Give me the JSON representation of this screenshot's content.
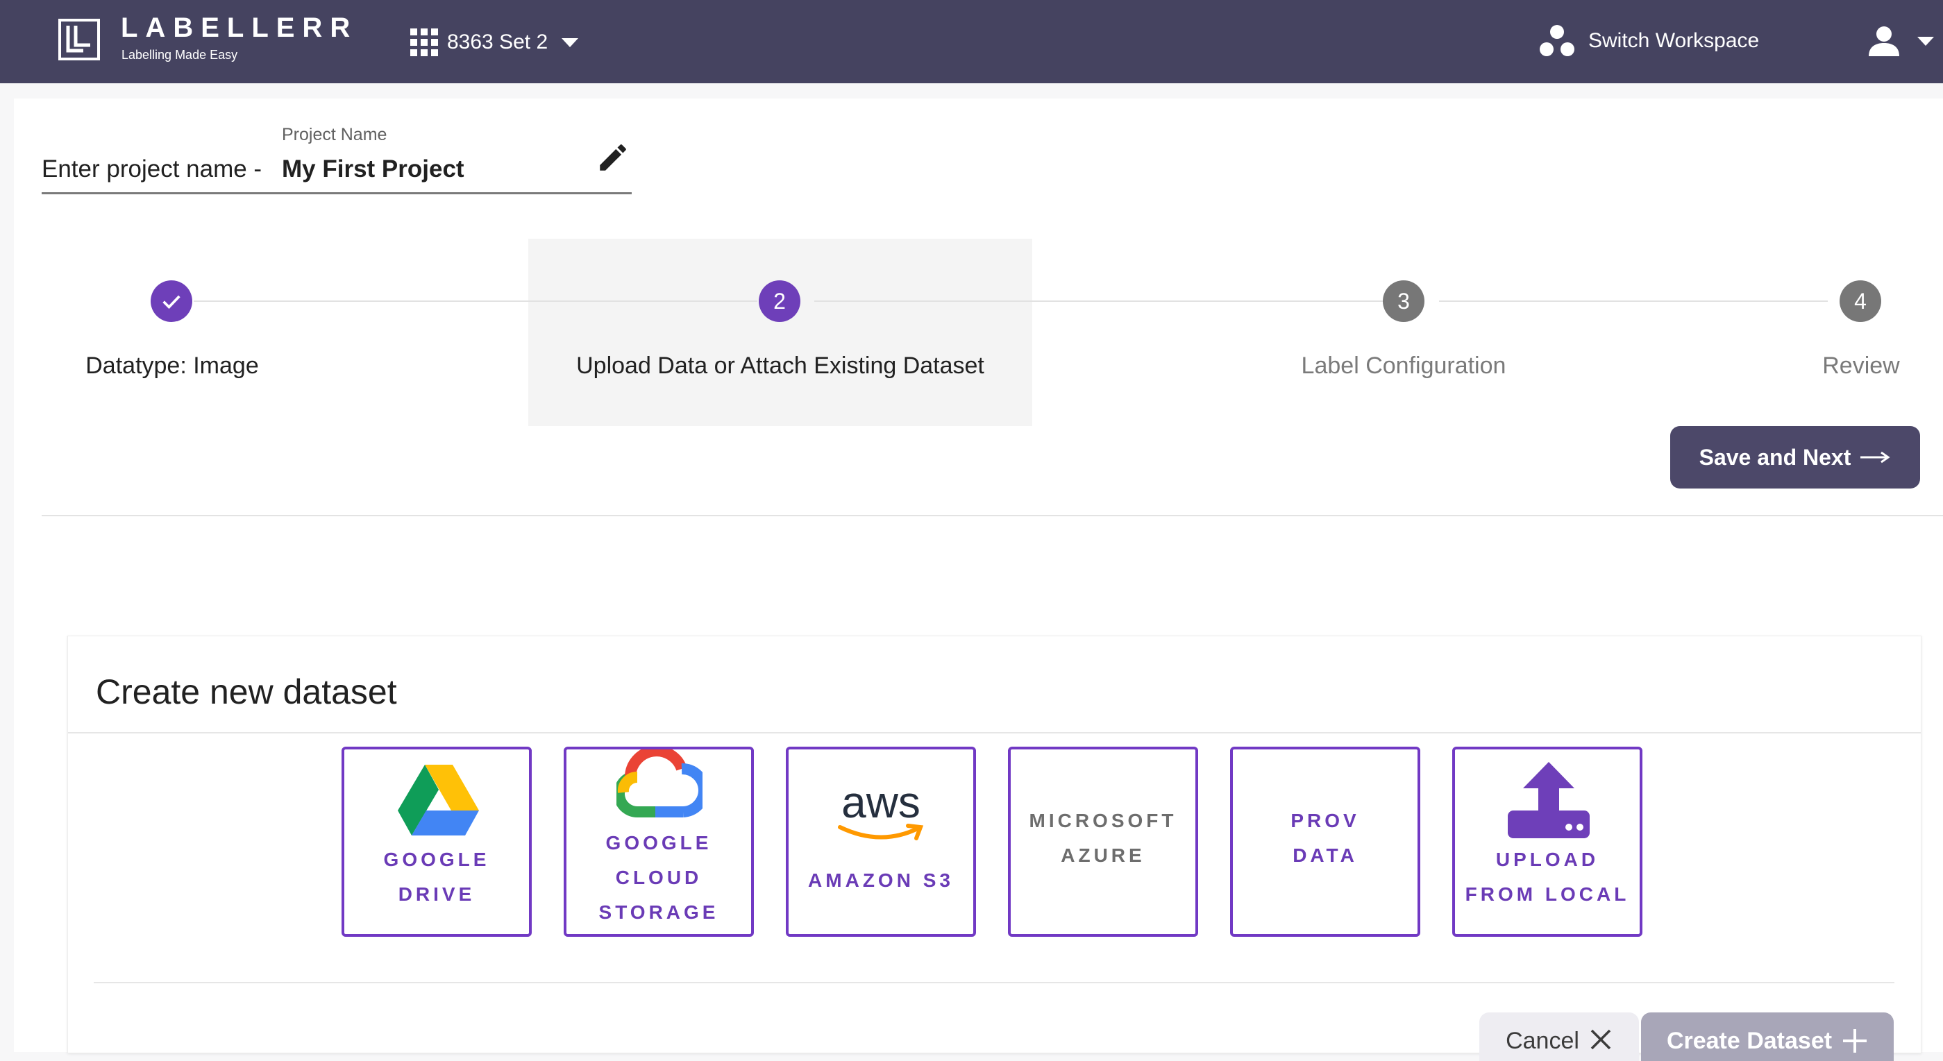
{
  "header": {
    "brand_name": "LABELLERR",
    "brand_tagline": "Labelling Made Easy",
    "workspace_label": "8363 Set 2",
    "switch_workspace_label": "Switch Workspace",
    "bar_color": "#454360"
  },
  "project": {
    "prefix_label": "Enter project name -",
    "field_label": "Project Name",
    "name": "My First Project"
  },
  "stepper": {
    "accent_color": "#6e3fb9",
    "steps": [
      {
        "number": "1",
        "label": "Datatype: Image",
        "status": "done"
      },
      {
        "number": "2",
        "label": "Upload Data or Attach Existing Dataset",
        "status": "current"
      },
      {
        "number": "3",
        "label": "Label Configuration",
        "status": "todo"
      },
      {
        "number": "4",
        "label": "Review",
        "status": "todo"
      }
    ]
  },
  "actions": {
    "save_next_label": "Save and Next"
  },
  "dataset": {
    "title": "Create new dataset",
    "sources": [
      {
        "name": "GOOGLE\nDRIVE",
        "icon": "google-drive-icon"
      },
      {
        "name": "GOOGLE\nCLOUD\nSTORAGE",
        "icon": "google-cloud-icon"
      },
      {
        "name": "AMAZON S3",
        "icon": "aws-icon",
        "logo_text": "aws"
      },
      {
        "name": "MICROSOFT\nAZURE",
        "icon": ""
      },
      {
        "name": "PROV\nDATA",
        "icon": ""
      },
      {
        "name": "UPLOAD\nFROM LOCAL",
        "icon": "upload-icon"
      }
    ],
    "cancel_label": "Cancel",
    "create_label": "Create Dataset"
  }
}
